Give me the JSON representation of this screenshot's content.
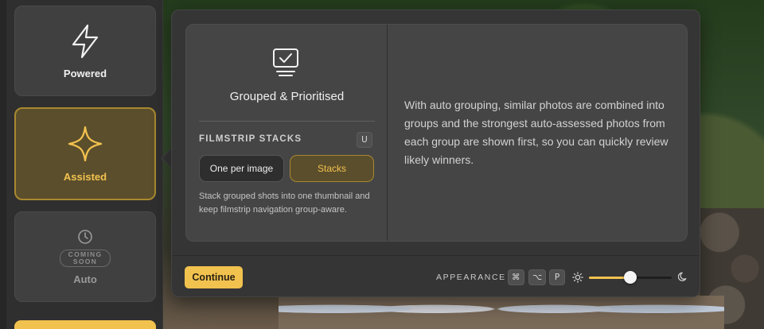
{
  "modes": {
    "powered": {
      "label": "Powered",
      "icon": "lightning-icon"
    },
    "assisted": {
      "label": "Assisted",
      "icon": "sparkle-icon",
      "accent": "#f2c24f"
    },
    "auto": {
      "label": "Auto",
      "badge": "COMING SOON",
      "icon": "clock-icon"
    }
  },
  "modal": {
    "feature_title": "Grouped & Prioritised",
    "feature_icon": "monitor-check-icon",
    "section_label": "FILMSTRIP STACKS",
    "section_shortcut": "U",
    "options": [
      {
        "label": "One per image",
        "selected": false
      },
      {
        "label": "Stacks",
        "selected": true
      }
    ],
    "help_text": "Stack grouped shots into one thumbnail and keep filmstrip navigation group-aware.",
    "description": "With auto grouping, similar photos are combined into groups and the strongest auto-assessed photos from each group are shown first, so you can quickly review likely winners."
  },
  "footer": {
    "continue_label": "Continue",
    "appearance_label": "APPEARANCE",
    "shortcut_keys": [
      "⌘",
      "⌥",
      "P"
    ],
    "brightness_value": 0.5
  },
  "colors": {
    "accent": "#f2c24f",
    "panel": "#454545",
    "modal": "#353535"
  }
}
